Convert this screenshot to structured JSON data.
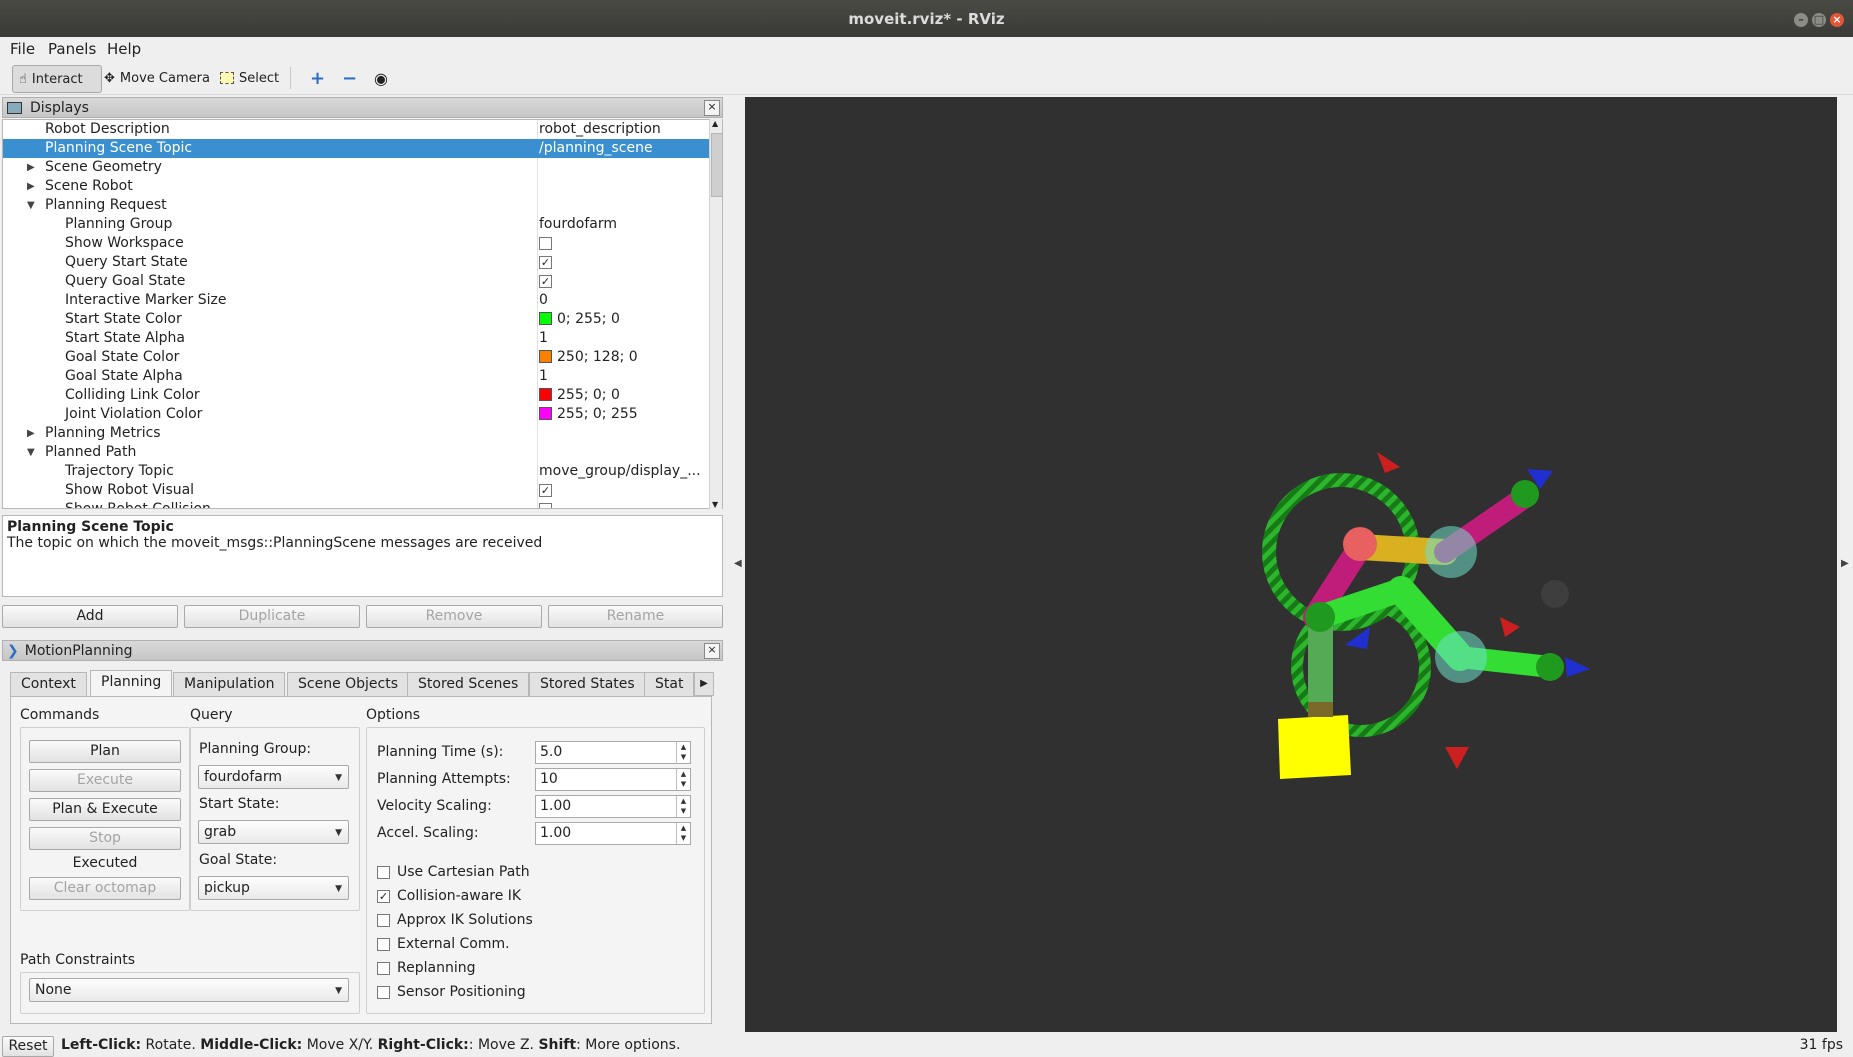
{
  "window": {
    "title": "moveit.rviz* - RViz"
  },
  "menu": [
    "File",
    "Panels",
    "Help"
  ],
  "toolbar": {
    "interact": "Interact",
    "move_camera": "Move Camera",
    "select": "Select",
    "icons": [
      "plus-icon",
      "minus-icon",
      "eye-icon"
    ]
  },
  "displays": {
    "title": "Displays",
    "rows": [
      {
        "key": "Robot Description",
        "value": "robot_description"
      },
      {
        "key": "Planning Scene Topic",
        "value": "/planning_scene"
      },
      {
        "key": "Scene Geometry",
        "value": ""
      },
      {
        "key": "Scene Robot",
        "value": ""
      },
      {
        "key": "Planning Request",
        "value": ""
      },
      {
        "key": "Planning Group",
        "value": "fourdofarm"
      },
      {
        "key": "Show Workspace",
        "value": ""
      },
      {
        "key": "Query Start State",
        "value": "✓"
      },
      {
        "key": "Query Goal State",
        "value": "✓"
      },
      {
        "key": "Interactive Marker Size",
        "value": "0"
      },
      {
        "key": "Start State Color",
        "value": "0; 255; 0"
      },
      {
        "key": "Start State Alpha",
        "value": "1"
      },
      {
        "key": "Goal State Color",
        "value": "250; 128; 0"
      },
      {
        "key": "Goal State Alpha",
        "value": "1"
      },
      {
        "key": "Colliding Link Color",
        "value": "255; 0; 0"
      },
      {
        "key": "Joint Violation Color",
        "value": "255; 0; 255"
      },
      {
        "key": "Planning Metrics",
        "value": ""
      },
      {
        "key": "Planned Path",
        "value": ""
      },
      {
        "key": "Trajectory Topic",
        "value": "move_group/display_..."
      },
      {
        "key": "Show Robot Visual",
        "value": "✓"
      },
      {
        "key": "Show Robot Collision",
        "value": ""
      }
    ],
    "colors": {
      "start": "#00ff00",
      "goal": "#fa8000",
      "colliding": "#ff0000",
      "violation": "#ff00ff"
    },
    "description": {
      "title": "Planning Scene Topic",
      "text": "The topic on which the moveit_msgs::PlanningScene messages are received"
    },
    "buttons": {
      "add": "Add",
      "duplicate": "Duplicate",
      "remove": "Remove",
      "rename": "Rename"
    }
  },
  "motion": {
    "title": "MotionPlanning",
    "tabs": [
      "Context",
      "Planning",
      "Manipulation",
      "Scene Objects",
      "Stored Scenes",
      "Stored States",
      "Stat"
    ],
    "commands": {
      "label": "Commands",
      "plan": "Plan",
      "execute": "Execute",
      "plan_execute": "Plan & Execute",
      "stop": "Stop",
      "status": "Executed",
      "clear_octomap": "Clear octomap"
    },
    "query": {
      "label": "Query",
      "planning_group_label": "Planning Group:",
      "planning_group": "fourdofarm",
      "start_state_label": "Start State:",
      "start_state": "grab",
      "goal_state_label": "Goal State:",
      "goal_state": "pickup"
    },
    "options": {
      "label": "Options",
      "planning_time_label": "Planning Time (s):",
      "planning_time": "5.0",
      "planning_attempts_label": "Planning Attempts:",
      "planning_attempts": "10",
      "velocity_scaling_label": "Velocity Scaling:",
      "velocity_scaling": "1.00",
      "accel_scaling_label": "Accel. Scaling:",
      "accel_scaling": "1.00",
      "use_cartesian_path": "Use Cartesian Path",
      "collision_aware_ik": "Collision-aware IK",
      "approx_ik": "Approx IK Solutions",
      "external_comm": "External Comm.",
      "replanning": "Replanning",
      "sensor_positioning": "Sensor Positioning"
    },
    "path_constraints": {
      "label": "Path Constraints",
      "value": "None"
    }
  },
  "status": {
    "reset": "Reset",
    "left_click": "Left-Click:",
    "left_click_desc": " Rotate. ",
    "middle_click": "Middle-Click:",
    "middle_click_desc": " Move X/Y. ",
    "right_click": "Right-Click:",
    "right_click_desc": ": Move Z. ",
    "shift": "Shift",
    "shift_desc": ": More options.",
    "fps": "31 fps"
  }
}
